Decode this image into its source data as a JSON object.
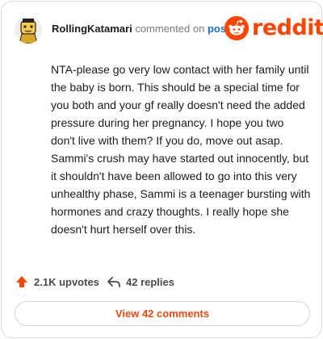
{
  "comment": {
    "username": "RollingKatamari",
    "action_text": "commented on",
    "target_link": "post",
    "body": "NTA-please go very low contact with her family until the baby is born. This should be a special time for you both and your gf really doesn't need the added pressure during her pregnancy. I hope you two don't live with them? If you do, move out asap. Sammi's crush may have started out innocently, but it shouldn't have been allowed to go into this very unhealthy phase, Sammi is a teenager bursting with hormones and crazy thoughts. I really hope she doesn't hurt herself over this."
  },
  "brand": {
    "name": "reddit",
    "color": "#ff4500"
  },
  "stats": {
    "upvotes": "2.1K upvotes",
    "replies": "42 replies"
  },
  "footer": {
    "view_comments_label": "View 42 comments"
  },
  "icons": {
    "avatar": "avatar-icon",
    "logo": "reddit-logo-icon",
    "upvote": "upvote-arrow-icon",
    "reply": "reply-arrow-icon"
  }
}
